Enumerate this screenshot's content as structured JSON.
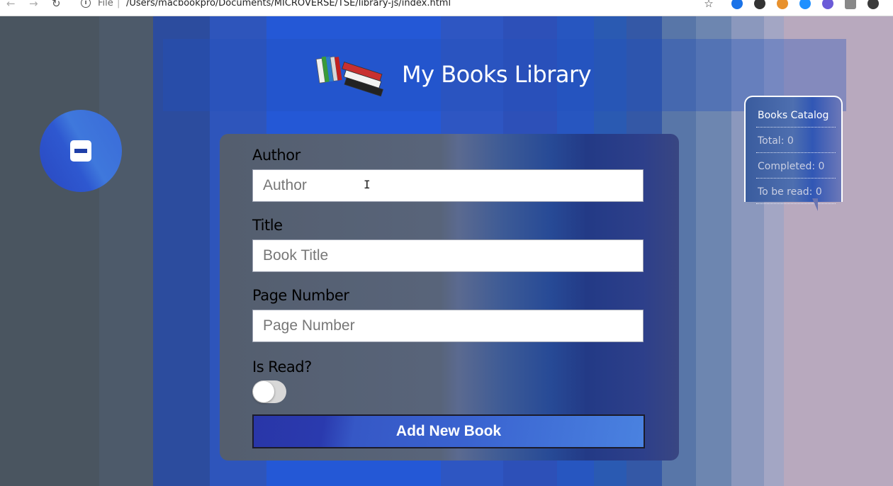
{
  "browser": {
    "back_glyph": "←",
    "forward_glyph": "→",
    "reload_glyph": "↻",
    "info_glyph": "i",
    "file_label": "File",
    "separator": "|",
    "url": "/Users/macbookpro/Documents/MICROVERSE/TSE/library-js/index.html",
    "star_glyph": "☆"
  },
  "header": {
    "title": "My Books Library",
    "logo_icon": "books-stack-icon"
  },
  "toggle_button": {
    "icon": "minus-icon"
  },
  "catalog": {
    "heading": "Books Catalog",
    "total": "Total: 0",
    "completed": "Completed: 0",
    "to_be_read": "To be read: 0"
  },
  "form": {
    "author_label": "Author",
    "author_placeholder": "Author",
    "author_value": "",
    "title_label": "Title",
    "title_placeholder": "Book Title",
    "title_value": "",
    "pages_label": "Page Number",
    "pages_placeholder": "Page Number",
    "pages_value": "",
    "is_read_label": "Is Read?",
    "is_read_checked": false,
    "submit_label": "Add New Book"
  },
  "colors": {
    "accent_blue": "#2f5bd3",
    "panel_dark": "#545e6e",
    "button_gradient_start": "#2936a8",
    "button_gradient_end": "#4a82e0"
  }
}
